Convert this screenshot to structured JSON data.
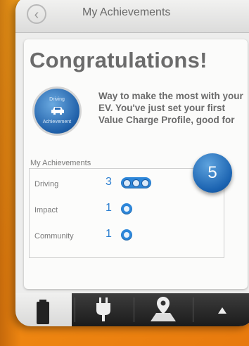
{
  "header": {
    "title": "My Achievements",
    "back_icon": "back-chevron-icon"
  },
  "card": {
    "title": "Congratulations!",
    "badge": {
      "top_text": "Driving",
      "bottom_text": "Achievement",
      "icon": "car-icon"
    },
    "message": "Way to make the most with your EV. You've just set your first Value Charge Profile, good for",
    "points": "5"
  },
  "achievements": {
    "label": "My Achievements",
    "rows": [
      {
        "name": "Driving",
        "count": "3"
      },
      {
        "name": "Impact",
        "count": "1"
      },
      {
        "name": "Community",
        "count": "1"
      }
    ]
  },
  "tabs": [
    {
      "name": "battery",
      "icon": "battery-icon",
      "active": true
    },
    {
      "name": "charge",
      "icon": "plug-icon",
      "active": false
    },
    {
      "name": "map",
      "icon": "map-pin-icon",
      "active": false
    },
    {
      "name": "more",
      "icon": "up-arrow-icon",
      "active": false
    }
  ],
  "colors": {
    "accent": "#2d86d9",
    "background": "#f08a12"
  }
}
